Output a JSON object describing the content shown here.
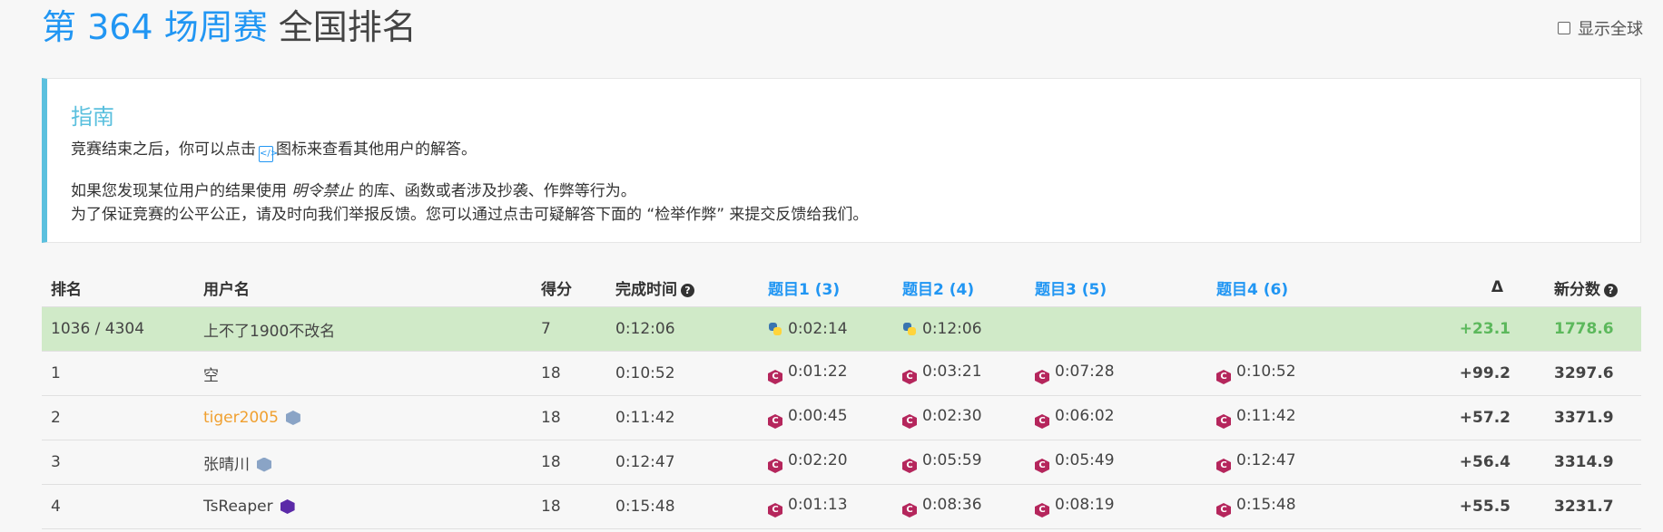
{
  "header": {
    "title_highlight": "第 364 场周赛",
    "title_rest": "全国排名",
    "show_all_label": "显示全球"
  },
  "guide": {
    "title": "指南",
    "line1_pre": "竞赛结束之后，你可以点击",
    "line1_post": "图标来查看其他用户的解答。",
    "line2_pre": "如果您发现某位用户的结果使用",
    "line2_em": "明令禁止",
    "line2_post": "的库、函数或者涉及抄袭、作弊等行为。",
    "line3": "为了保证竞赛的公平公正，请及时向我们举报反馈。您可以通过点击可疑解答下面的 “检举作弊” 来提交反馈给我们。"
  },
  "table": {
    "headers": {
      "rank": "排名",
      "user": "用户名",
      "score": "得分",
      "finish": "完成时间",
      "q1": "题目1 (3)",
      "q2": "题目2 (4)",
      "q3": "题目3 (5)",
      "q4": "题目4 (6)",
      "delta": "Δ",
      "new_score": "新分数"
    },
    "rows": [
      {
        "rank": "1036 / 4304",
        "user": "上不了1900不改名",
        "score": "7",
        "finish": "0:12:06",
        "q1": "0:02:14",
        "q1_lang": "python-icon",
        "q2": "0:12:06",
        "q2_lang": "python-icon",
        "q3": "",
        "q4": "",
        "delta": "+23.1",
        "new_score": "1778.6"
      },
      {
        "rank": "1",
        "user": "空",
        "score": "18",
        "finish": "0:10:52",
        "q1": "0:01:22",
        "q2": "0:03:21",
        "q3": "0:07:28",
        "q4": "0:10:52",
        "delta": "+99.2",
        "new_score": "3297.6"
      },
      {
        "rank": "2",
        "user": "tiger2005",
        "score": "18",
        "finish": "0:11:42",
        "q1": "0:00:45",
        "q2": "0:02:30",
        "q3": "0:06:02",
        "q4": "0:11:42",
        "delta": "+57.2",
        "new_score": "3371.9"
      },
      {
        "rank": "3",
        "user": "张晴川",
        "score": "18",
        "finish": "0:12:47",
        "q1": "0:02:20",
        "q2": "0:05:59",
        "q3": "0:05:49",
        "q4": "0:12:47",
        "delta": "+56.4",
        "new_score": "3314.9"
      },
      {
        "rank": "4",
        "user": "TsReaper",
        "score": "18",
        "finish": "0:15:48",
        "q1": "0:01:13",
        "q2": "0:08:36",
        "q3": "0:08:19",
        "q4": "0:15:48",
        "delta": "+55.5",
        "new_score": "3231.7"
      }
    ]
  },
  "colors": {
    "accent": "#2196f3",
    "guide_accent": "#5bc0de",
    "highlight_row": "#d0eac8",
    "positive": "#3c9a3c"
  }
}
